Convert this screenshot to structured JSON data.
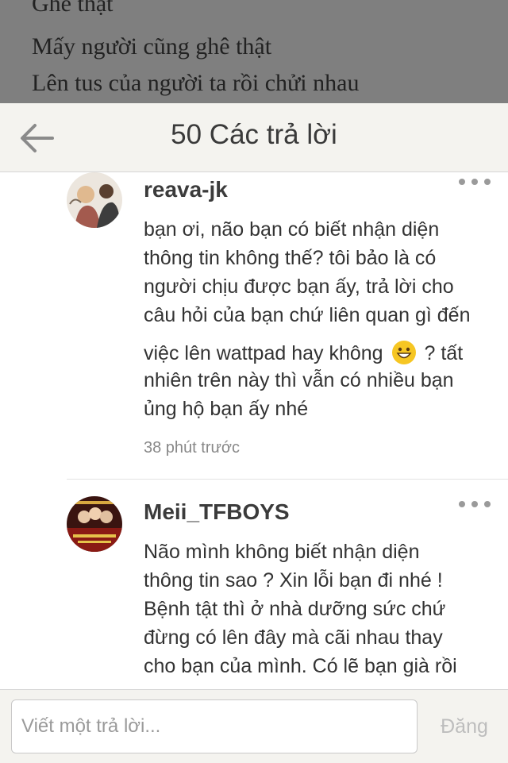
{
  "background_post": {
    "lines": [
      "Ghê thật",
      "Mấy người cũng ghê thật",
      "Lên tus của người ta rồi chửi nhau"
    ]
  },
  "header": {
    "title": "50 Các trả lời",
    "back_icon": "arrow-left-icon"
  },
  "comments": [
    {
      "username": "reava-jk",
      "lines": [
        "bạn ơi, não bạn có biết nhận diện",
        "thông tin không thế? tôi bảo là có",
        "người chịu được bạn ấy, trả lời cho",
        "câu hỏi của bạn chứ liên quan gì đến",
        "việc lên wattpad hay không",
        "? tất",
        "nhiên trên này thì vẫn có nhiều bạn",
        "ủng hộ bạn ấy nhé"
      ],
      "emoji": "grinning-face-emoji",
      "time": "38 phút trước"
    },
    {
      "username": "Meii_TFBOYS",
      "lines": [
        "Não mình không biết nhận diện",
        "thông tin sao ? Xin lỗi bạn đi nhé !",
        "Bệnh tật thì ở nhà dưỡng sức chứ",
        "đừng có lên đây mà cãi nhau thay",
        "cho bạn của mình. Có lẽ bạn già rồi"
      ]
    }
  ],
  "footer": {
    "placeholder": "Viết một trả lời...",
    "post_label": "Đăng"
  },
  "colors": {
    "overlay": "#7f7f7f",
    "header_bg": "#f4f3ef",
    "text": "#333333",
    "muted": "#888888"
  }
}
